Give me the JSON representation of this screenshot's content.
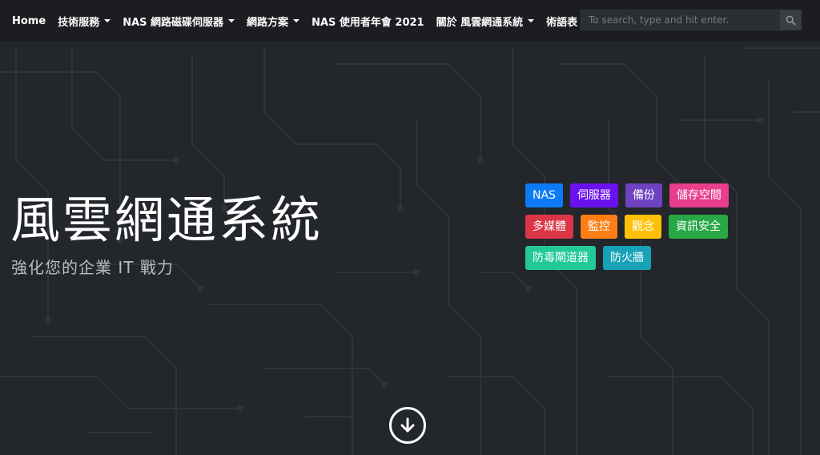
{
  "nav": {
    "items": [
      {
        "label": "Home",
        "dropdown": false
      },
      {
        "label": "技術服務",
        "dropdown": true
      },
      {
        "label": "NAS 網路磁碟伺服器",
        "dropdown": true
      },
      {
        "label": "網路方案",
        "dropdown": true
      },
      {
        "label": "NAS 使用者年會 2021",
        "dropdown": false
      },
      {
        "label": "關於 風雲網通系統",
        "dropdown": true
      },
      {
        "label": "術語表",
        "dropdown": false
      }
    ],
    "search_placeholder": "To search, type and hit enter.",
    "search_icon": "search-icon"
  },
  "hero": {
    "title": "風雲網通系統",
    "subtitle": "強化您的企業 IT 戰力"
  },
  "tags": [
    [
      {
        "label": "NAS",
        "color": "#0d7bf5"
      },
      {
        "label": "伺服器",
        "color": "#6a11f0"
      },
      {
        "label": "備份",
        "color": "#6f42c1"
      },
      {
        "label": "儲存空間",
        "color": "#e83e8c"
      }
    ],
    [
      {
        "label": "多媒體",
        "color": "#dc3545"
      },
      {
        "label": "監控",
        "color": "#fd7e14"
      },
      {
        "label": "觀念",
        "color": "#ffc107"
      },
      {
        "label": "資訊安全",
        "color": "#28a745"
      }
    ],
    [
      {
        "label": "防毒閘道器",
        "color": "#20c997"
      },
      {
        "label": "防火牆",
        "color": "#17a2b8"
      }
    ]
  ],
  "scroll_icon": "arrow-down-circle-icon",
  "colors": {
    "navbar_bg": "#1b1d21",
    "hero_bg": "#23262b",
    "circuit_line": "#33363c"
  }
}
